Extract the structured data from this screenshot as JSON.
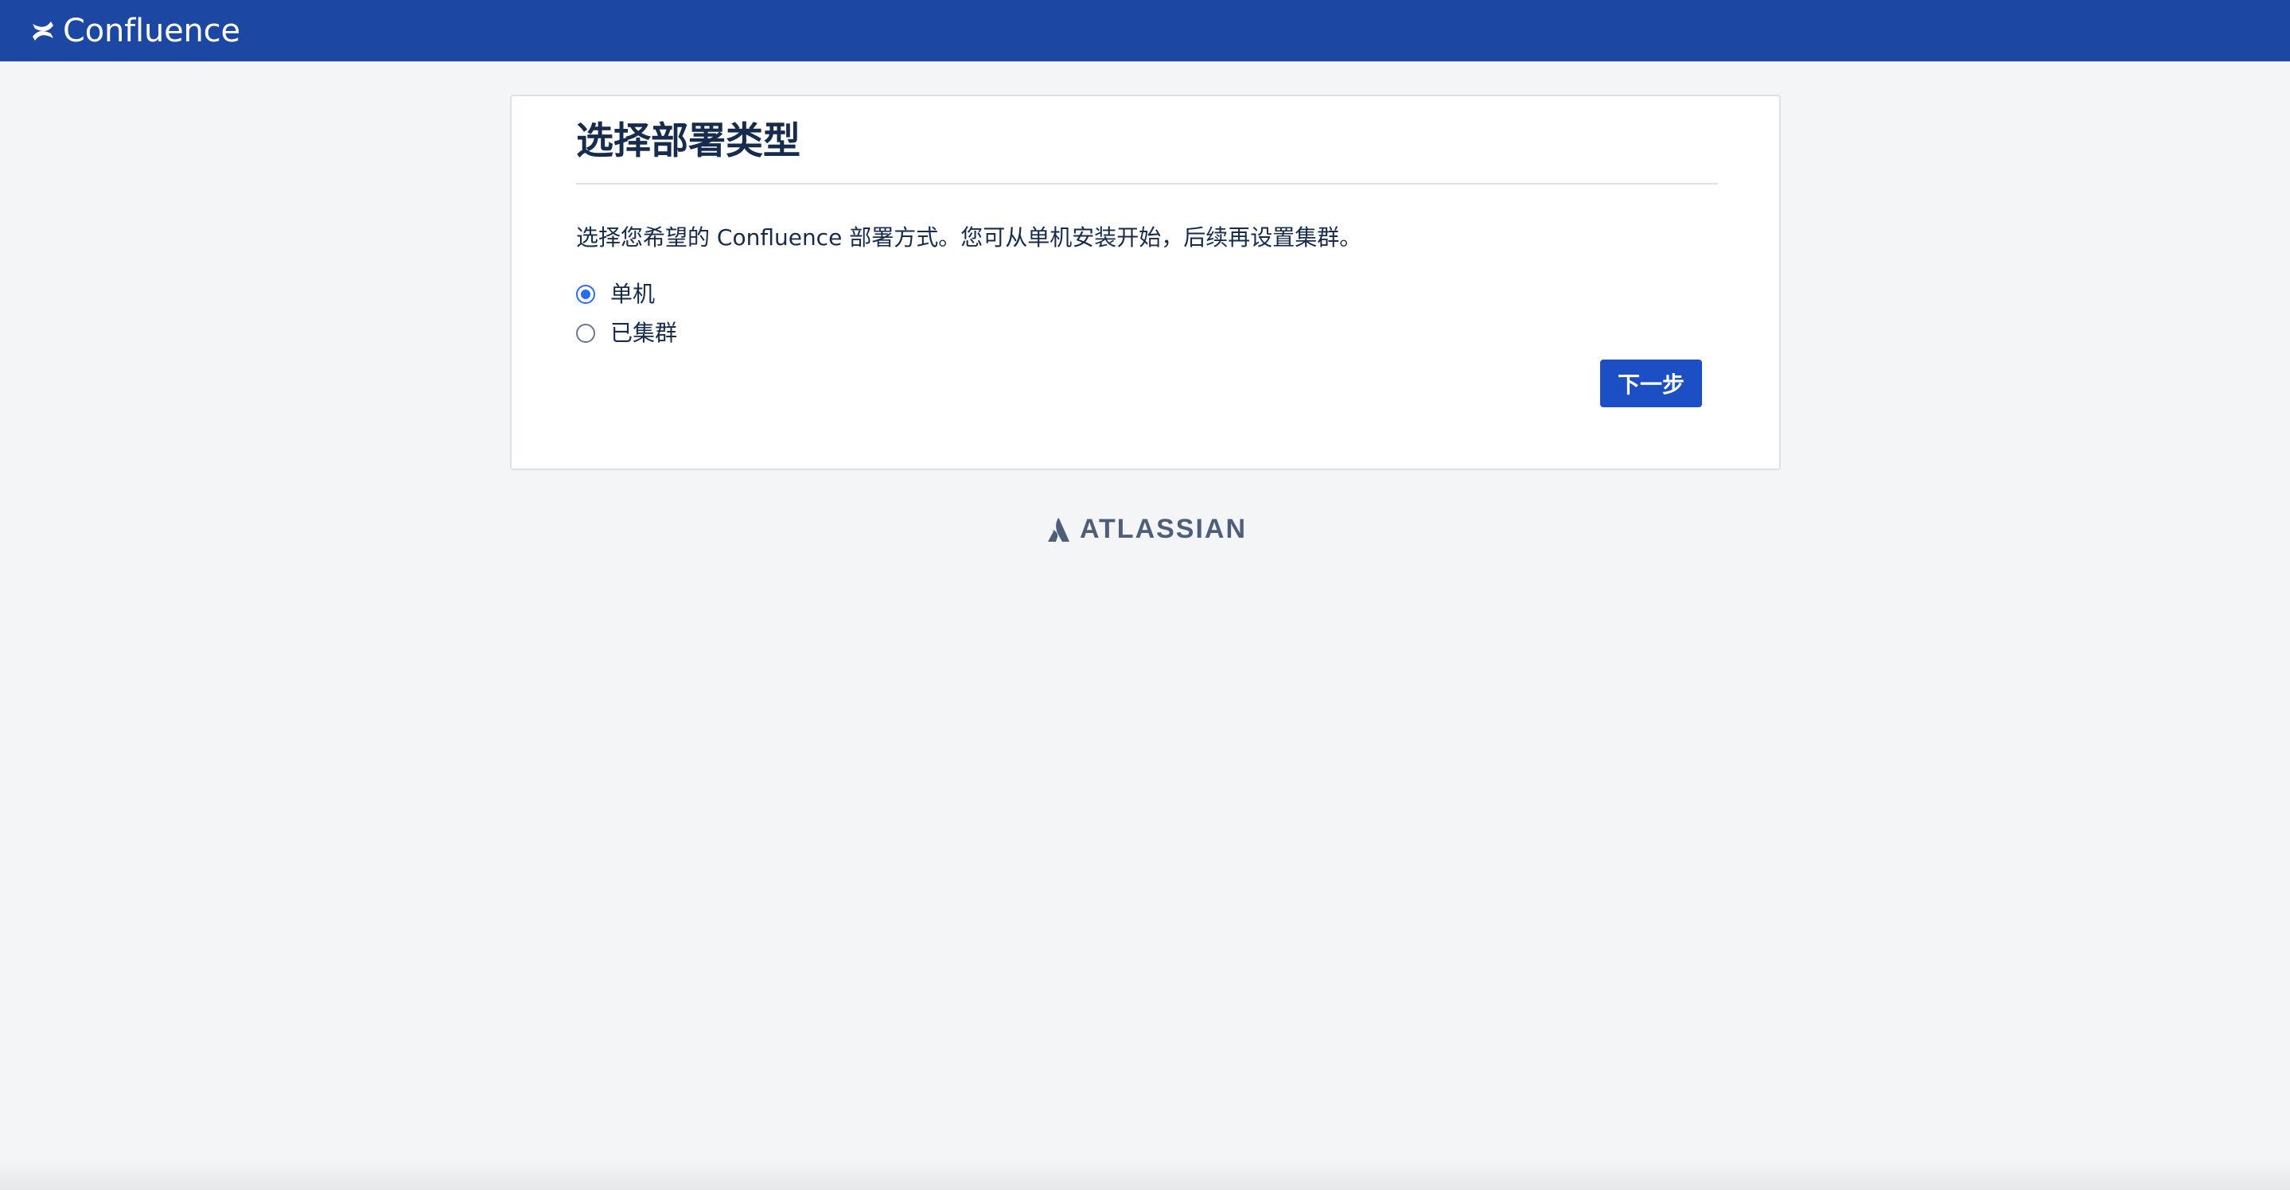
{
  "header": {
    "app_name": "Confluence",
    "background_color": "#1c47a3",
    "icon": "confluence-logo-icon"
  },
  "setup": {
    "title": "选择部署类型",
    "description": "选择您希望的 Confluence 部署方式。您可从单机安装开始，后续再设置集群。",
    "options": [
      {
        "label": "单机",
        "selected": true
      },
      {
        "label": "已集群",
        "selected": false
      }
    ],
    "next_button": "下一步",
    "accent_color": "#1c4fc4"
  },
  "footer": {
    "brand": "ATLASSIAN",
    "icon": "atlassian-logo-icon"
  }
}
